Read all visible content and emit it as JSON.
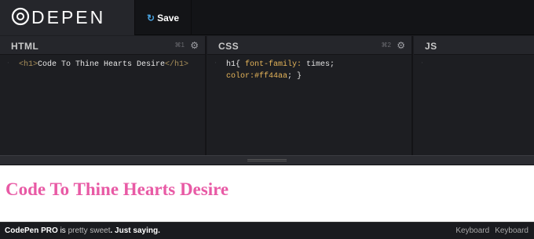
{
  "header": {
    "logo_text": "C",
    "logo_rest": "DEPEN",
    "save_label": "Save"
  },
  "panes": {
    "html": {
      "title": "HTML",
      "shortcut": "⌘1"
    },
    "css": {
      "title": "CSS",
      "shortcut": "⌘2"
    },
    "js": {
      "title": "JS"
    }
  },
  "html_code": {
    "open_tag": "<h1>",
    "content": "Code To Thine Hearts Desire",
    "close_tag": "</h1>"
  },
  "css_code": {
    "line1_selector": "h1{ ",
    "line1_prop": "font-family:",
    "line1_value": " times;",
    "line2_prop": "color:",
    "line2_value": "#ff44aa",
    "line2_end": "; }"
  },
  "preview": {
    "heading": "Code To Thine Hearts Desire",
    "heading_color": "#e85aa5"
  },
  "footer": {
    "pro_label": "CodePen PRO",
    "is_text": " is ",
    "pretty_text": "pretty sweet",
    "tail": ". Just saying.",
    "keyboard_1": "Keyboard",
    "keyboard_2": "Keyboard"
  }
}
